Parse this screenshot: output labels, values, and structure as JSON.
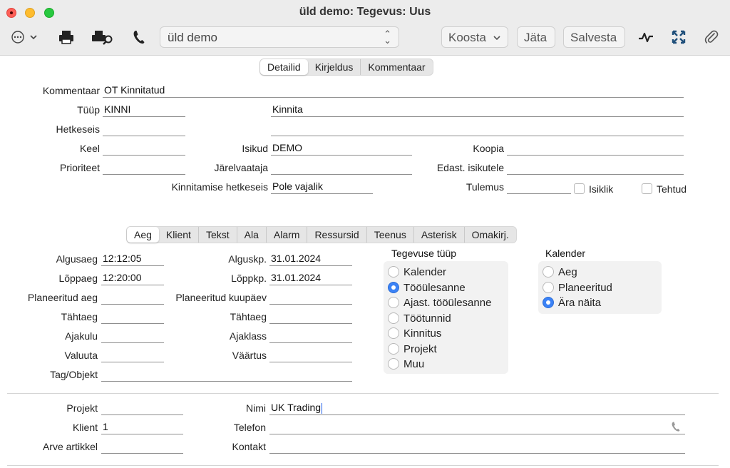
{
  "window": {
    "title": "üld demo: Tegevus: Uus"
  },
  "toolbar": {
    "combo_value": "üld demo",
    "koosta": "Koosta",
    "jata": "Jäta",
    "salvesta": "Salvesta",
    "icons": [
      "more-icon",
      "print-icon",
      "print-preview-icon",
      "phone-icon",
      "activity-icon",
      "expand-icon",
      "attachment-icon"
    ]
  },
  "top_tabs": [
    "Detailid",
    "Kirjeldus",
    "Kommentaar"
  ],
  "form": {
    "kommentaar": {
      "label": "Kommentaar",
      "value": "OT Kinnitatud"
    },
    "tyyp": {
      "label": "Tüüp",
      "value": "KINNI",
      "desc": "Kinnita"
    },
    "hetkeseis": {
      "label": "Hetkeseis",
      "value": ""
    },
    "keel": {
      "label": "Keel",
      "value": ""
    },
    "isikud": {
      "label": "Isikud",
      "value": "DEMO"
    },
    "koopia": {
      "label": "Koopia",
      "value": ""
    },
    "prioriteet": {
      "label": "Prioriteet",
      "value": ""
    },
    "jarelvaataja": {
      "label": "Järelvaataja",
      "value": ""
    },
    "edast": {
      "label": "Edast. isikutele",
      "value": ""
    },
    "kinnitamise": {
      "label": "Kinnitamise hetkeseis",
      "value": "Pole vajalik"
    },
    "tulemus": {
      "label": "Tulemus",
      "value": ""
    },
    "isiklik": {
      "label": "Isiklik",
      "checked": false
    },
    "tehtud": {
      "label": "Tehtud",
      "checked": false
    }
  },
  "sub_tabs": [
    "Aeg",
    "Klient",
    "Tekst",
    "Ala",
    "Alarm",
    "Ressursid",
    "Teenus",
    "Asterisk",
    "Omakirj."
  ],
  "aeg": {
    "algusaeg": {
      "label": "Algusaeg",
      "value": "12:12:05"
    },
    "loppaeg": {
      "label": "Lõppaeg",
      "value": "12:20:00"
    },
    "planeeritud_aeg": {
      "label": "Planeeritud aeg",
      "value": ""
    },
    "tahtaeg": {
      "label": "Tähtaeg",
      "value": ""
    },
    "ajakulu": {
      "label": "Ajakulu",
      "value": ""
    },
    "valuuta": {
      "label": "Valuuta",
      "value": ""
    },
    "tag_objekt": {
      "label": "Tag/Objekt",
      "value": ""
    },
    "alguskp": {
      "label": "Alguskp.",
      "value": "31.01.2024"
    },
    "loppkp": {
      "label": "Lõppkp.",
      "value": "31.01.2024"
    },
    "planeeritud_kuupaev": {
      "label": "Planeeritud kuupäev",
      "value": ""
    },
    "tahtaeg2": {
      "label": "Tähtaeg",
      "value": ""
    },
    "ajaklass": {
      "label": "Ajaklass",
      "value": ""
    },
    "vaartus": {
      "label": "Väärtus",
      "value": ""
    }
  },
  "tegevuse_tyyp": {
    "title": "Tegevuse tüüp",
    "options": [
      "Kalender",
      "Tööülesanne",
      "Ajast. tööülesanne",
      "Töötunnid",
      "Kinnitus",
      "Projekt",
      "Muu"
    ],
    "selected": "Tööülesanne"
  },
  "kalender": {
    "title": "Kalender",
    "options": [
      "Aeg",
      "Planeeritud",
      "Ära näita"
    ],
    "selected": "Ära näita"
  },
  "bottom": {
    "projekt": {
      "label": "Projekt",
      "value": ""
    },
    "klient": {
      "label": "Klient",
      "value": "1"
    },
    "arve_artikkel": {
      "label": "Arve artikkel",
      "value": ""
    },
    "nimi": {
      "label": "Nimi",
      "value": "UK Trading"
    },
    "telefon": {
      "label": "Telefon",
      "value": ""
    },
    "kontakt": {
      "label": "Kontakt",
      "value": ""
    }
  }
}
